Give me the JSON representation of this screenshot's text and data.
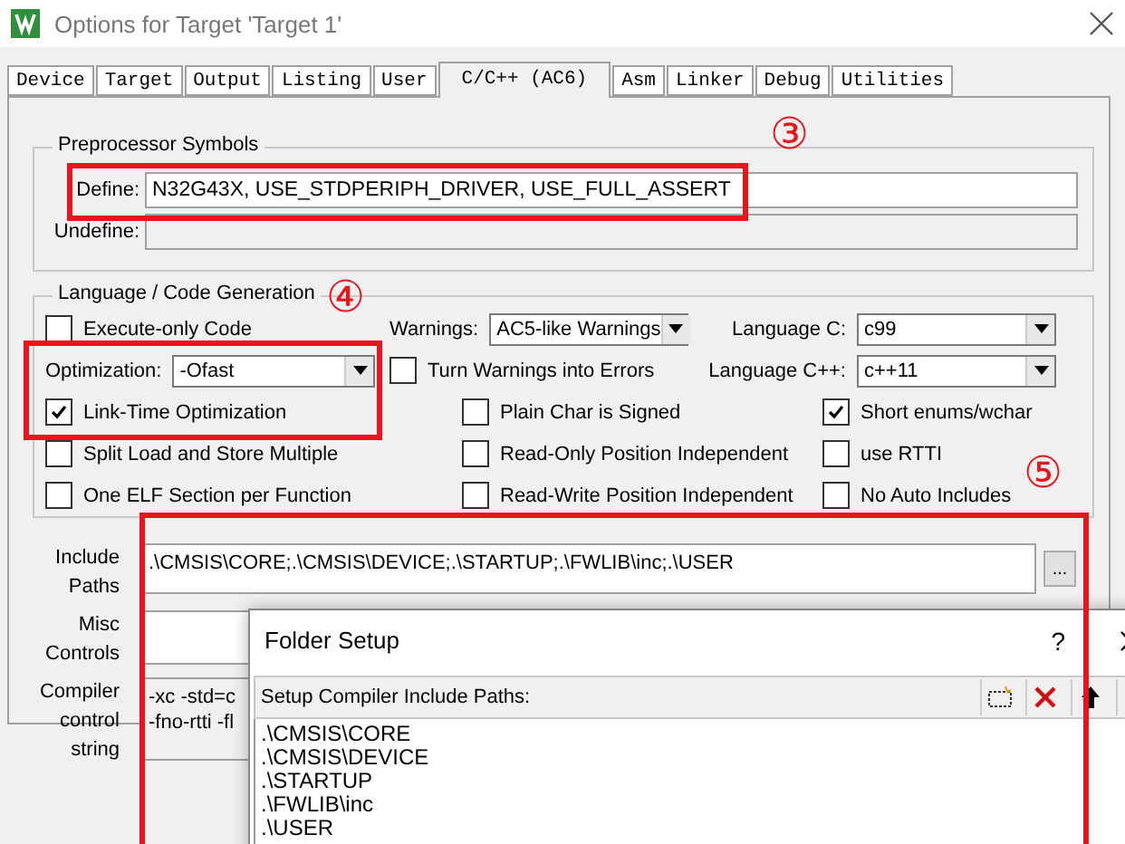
{
  "window": {
    "title": "Options for Target 'Target 1'"
  },
  "tabs": [
    {
      "label": "Device",
      "selected": false
    },
    {
      "label": "Target",
      "selected": false
    },
    {
      "label": "Output",
      "selected": false
    },
    {
      "label": "Listing",
      "selected": false
    },
    {
      "label": "User",
      "selected": false
    },
    {
      "label": "C/C++ (AC6)",
      "selected": true
    },
    {
      "label": "Asm",
      "selected": false
    },
    {
      "label": "Linker",
      "selected": false
    },
    {
      "label": "Debug",
      "selected": false
    },
    {
      "label": "Utilities",
      "selected": false
    }
  ],
  "preprocessor": {
    "title": "Preprocessor Symbols",
    "define_label": "Define:",
    "define_value": "N32G43X, USE_STDPERIPH_DRIVER, USE_FULL_ASSERT",
    "undefine_label": "Undefine:"
  },
  "language": {
    "title": "Language / Code Generation",
    "rows": [
      [
        {
          "kind": "checkbox",
          "label": "Execute-only Code",
          "checked": false
        },
        {
          "kind": "select",
          "label": "Warnings:",
          "value": "AC5-like Warnings"
        },
        {
          "kind": "select",
          "label": "Language C:",
          "value": "c99"
        }
      ],
      [
        {
          "kind": "select",
          "label": "Optimization:",
          "value": "-Ofast"
        },
        {
          "kind": "checkbox",
          "label": "Turn Warnings into Errors",
          "checked": false
        },
        {
          "kind": "select",
          "label": "Language C++:",
          "value": "c++11"
        }
      ],
      [
        {
          "kind": "checkbox",
          "label": "Link-Time Optimization",
          "checked": true
        },
        {
          "kind": "checkbox",
          "label": "Plain Char is Signed",
          "checked": false
        },
        {
          "kind": "checkbox",
          "label": "Short enums/wchar",
          "checked": true
        }
      ],
      [
        {
          "kind": "checkbox",
          "label": "Split Load and Store Multiple",
          "checked": false
        },
        {
          "kind": "checkbox",
          "label": "Read-Only Position Independent",
          "checked": false
        },
        {
          "kind": "checkbox",
          "label": "use RTTI",
          "checked": false
        }
      ],
      [
        {
          "kind": "checkbox",
          "label": "One ELF Section per Function",
          "checked": false
        },
        {
          "kind": "checkbox",
          "label": "Read-Write Position Independent",
          "checked": false
        },
        {
          "kind": "checkbox",
          "label": "No Auto Includes",
          "checked": false
        }
      ]
    ]
  },
  "include_paths": {
    "label": "Include Paths",
    "value": ".\\CMSIS\\CORE;.\\CMSIS\\DEVICE;.\\STARTUP;.\\FWLIB\\inc;.\\USER",
    "browse": "..."
  },
  "misc_controls": {
    "label": "Misc Controls"
  },
  "compiler_control": {
    "label": "Compiler control string",
    "lines": [
      "-xc -std=c",
      "-fno-rtti -fl"
    ]
  },
  "folder_setup": {
    "title": "Folder Setup",
    "help": "?",
    "heading": "Setup Compiler Include Paths:",
    "paths": [
      ".\\CMSIS\\CORE",
      ".\\CMSIS\\DEVICE",
      ".\\STARTUP",
      ".\\FWLIB\\inc",
      ".\\USER"
    ]
  },
  "annotations": [
    "③",
    "④",
    "⑤"
  ]
}
